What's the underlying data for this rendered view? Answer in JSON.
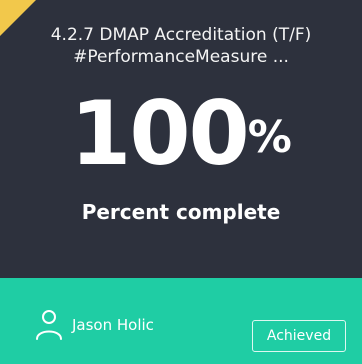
{
  "card": {
    "title_line1": "4.2.7 DMAP Accreditation (T/F)",
    "title_line2": "#PerformanceMeasure ...",
    "value": "100",
    "unit": "%",
    "subtitle": "Percent complete"
  },
  "footer": {
    "user_name": "Jason Holic",
    "status_label": "Achieved",
    "icon": "user-icon"
  },
  "colors": {
    "card_background": "#2d313d",
    "footer_background": "#1fcda4",
    "corner_flag": "#f2c84b"
  }
}
